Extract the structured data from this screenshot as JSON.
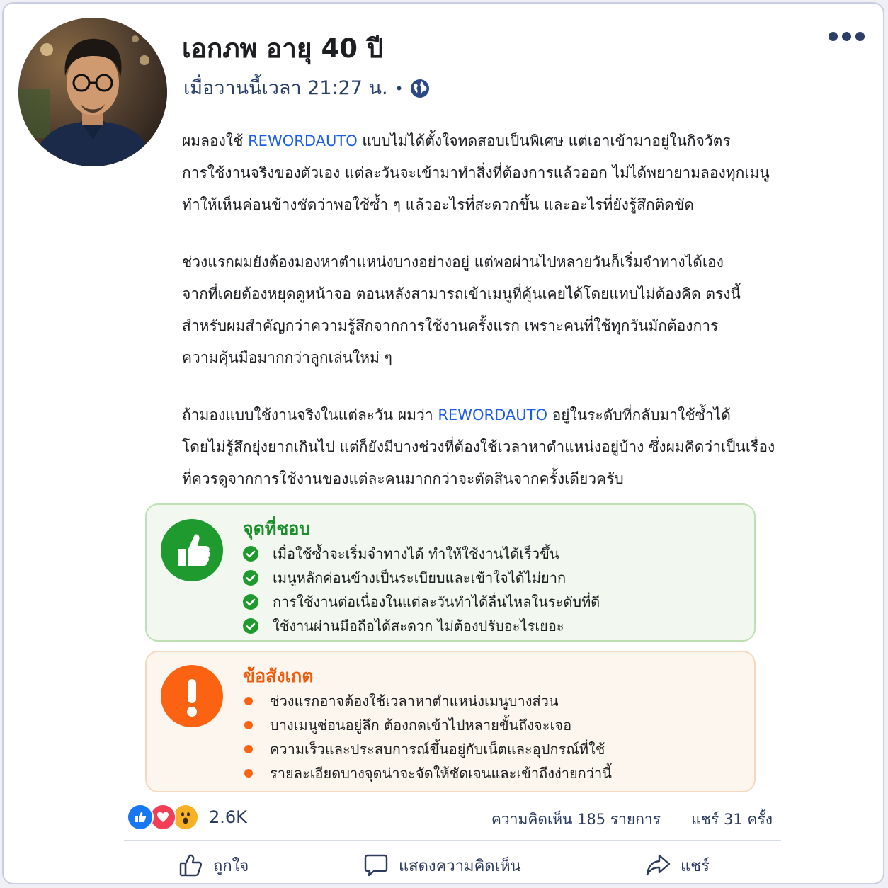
{
  "post": {
    "author": "เอกภพ อายุ 40 ปี",
    "timestamp": "เมื่อวานนี้เวลา 21:27 น.",
    "separator": "•",
    "paragraphs": [
      [
        "ผมลองใช้ ",
        "REWORDAUTO",
        " แบบไม่ได้ตั้งใจทดสอบเป็นพิเศษ แต่เอาเข้ามาอยู่ในกิจวัตร\nการใช้งานจริงของตัวเอง แต่ละวันจะเข้ามาทำสิ่งที่ต้องการแล้วออก ไม่ได้พยายามลองทุกเมนู\nทำให้เห็นค่อนข้างชัดว่าพอใช้ซ้ำ ๆ แล้วอะไรที่สะดวกขึ้น และอะไรที่ยังรู้สึกติดขัด"
      ],
      "ช่วงแรกผมยังต้องมองหาตำแหน่งบางอย่างอยู่ แต่พอผ่านไปหลายวันก็เริ่มจำทางได้เอง\nจากที่เคยต้องหยุดดูหน้าจอ ตอนหลังสามารถเข้าเมนูที่คุ้นเคยได้โดยแทบไม่ต้องคิด ตรงนี้\nสำหรับผมสำคัญกว่าความรู้สึกจากการใช้งานครั้งแรก เพราะคนที่ใช้ทุกวันมักต้องการ\nความคุ้นมือมากกว่าลูกเล่นใหม่ ๆ",
      [
        "ถ้ามองแบบใช้งานจริงในแต่ละวัน ผมว่า ",
        "REWORDAUTO",
        " อยู่ในระดับที่กลับมาใช้ซ้ำได้\nโดยไม่รู้สึกยุ่งยากเกินไป แต่ก็ยังมีบางช่วงที่ต้องใช้เวลาหาตำแหน่งอยู่บ้าง ซึ่งผมคิดว่าเป็นเรื่อง\nที่ควรดูจากการใช้งานของแต่ละคนมากกว่าจะตัดสินจากครั้งเดียวครับ"
      ]
    ]
  },
  "likes_box": {
    "title": "จุดที่ชอบ",
    "items": [
      "เมื่อใช้ซ้ำจะเริ่มจำทางได้ ทำให้ใช้งานได้เร็วขึ้น",
      "เมนูหลักค่อนข้างเป็นระเบียบและเข้าใจได้ไม่ยาก",
      "การใช้งานต่อเนื่องในแต่ละวันทำได้ลื่นไหลในระดับที่ดี",
      "ใช้งานผ่านมือถือได้สะดวก ไม่ต้องปรับอะไรเยอะ"
    ],
    "icon": "thumbs-up-icon",
    "color": "#1e9a2e"
  },
  "notes_box": {
    "title": "ข้อสังเกต",
    "items": [
      "ช่วงแรกอาจต้องใช้เวลาหาตำแหน่งเมนูบางส่วน",
      "บางเมนูซ่อนอยู่ลึก ต้องกดเข้าไปหลายขั้นถึงจะเจอ",
      "ความเร็วและประสบการณ์ขึ้นอยู่กับเน็ตและอุปกรณ์ที่ใช้",
      "รายละเอียดบางจุดน่าจะจัดให้ชัดเจนและเข้าถึงง่ายกว่านี้"
    ],
    "icon": "exclamation-icon",
    "color": "#fb6312"
  },
  "stats": {
    "reaction_count": "2.6K",
    "comments": "ความคิดเห็น 185 รายการ",
    "shares": "แชร์ 31 ครั้ง"
  },
  "actions": {
    "like": "ถูกใจ",
    "comment": "แสดงความคิดเห็น",
    "share": "แชร์"
  },
  "colors": {
    "brand_link": "#1a5de6",
    "meta_text": "#283f6a"
  }
}
